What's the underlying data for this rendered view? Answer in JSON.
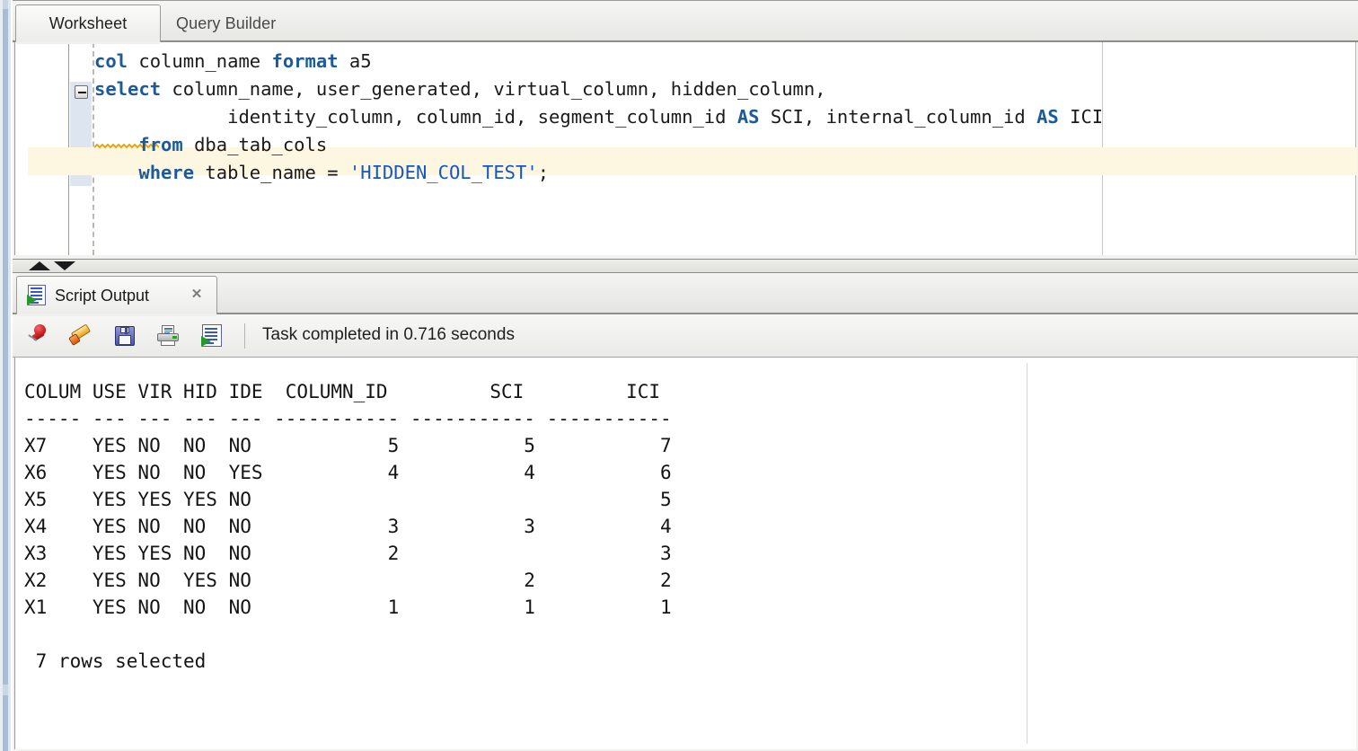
{
  "editor": {
    "tabs": [
      {
        "label": "Worksheet",
        "active": true
      },
      {
        "label": "Query Builder",
        "active": false
      }
    ],
    "code_lines": [
      [
        {
          "t": "col",
          "c": "kw"
        },
        {
          "t": " column_name ",
          "c": ""
        },
        {
          "t": "format",
          "c": "kw"
        },
        {
          "t": " a5",
          "c": ""
        }
      ],
      [
        {
          "t": "select",
          "c": "kw"
        },
        {
          "t": " column_name, user_generated, virtual_column, hidden_column,",
          "c": ""
        }
      ],
      [
        {
          "t": "            identity_column, column_id, segment_column_id ",
          "c": ""
        },
        {
          "t": "AS",
          "c": "kw"
        },
        {
          "t": " SCI, internal_column_id ",
          "c": ""
        },
        {
          "t": "AS",
          "c": "kw"
        },
        {
          "t": " ICI",
          "c": ""
        }
      ],
      [
        {
          "t": "    ",
          "c": ""
        },
        {
          "t": "from",
          "c": "kw"
        },
        {
          "t": " dba_tab_cols",
          "c": ""
        }
      ],
      [
        {
          "t": "    ",
          "c": ""
        },
        {
          "t": "where",
          "c": "kw"
        },
        {
          "t": " table_name = ",
          "c": ""
        },
        {
          "t": "'HIDDEN_COL_TEST'",
          "c": "str"
        },
        {
          "t": ";",
          "c": ""
        }
      ]
    ],
    "fold_icon": "collapse-minus-icon",
    "colors": {
      "keyword": "#1d5a9c",
      "string": "#1556c4",
      "highlight_band": "#fdf6e0",
      "squiggle": "#e8a317"
    }
  },
  "splitter": {
    "up_icon": "triangle-up-icon",
    "down_icon": "triangle-down-icon"
  },
  "output": {
    "tab": {
      "label": "Script Output",
      "close_label": "✕",
      "icon": "script-output-icon"
    },
    "toolbar": {
      "buttons": [
        {
          "name": "pin-button",
          "icon": "pushpin-icon",
          "title": "Pin"
        },
        {
          "name": "clear-button",
          "icon": "eraser-icon",
          "title": "Clear"
        },
        {
          "name": "save-button",
          "icon": "floppy-disk-icon",
          "title": "Save"
        },
        {
          "name": "print-button",
          "icon": "printer-icon",
          "title": "Print"
        },
        {
          "name": "run-script-button",
          "icon": "script-output-icon",
          "title": "Run Script"
        }
      ],
      "status": "Task completed in 0.716 seconds"
    },
    "result_text": "COLUM USE VIR HID IDE  COLUMN_ID         SCI         ICI\n----- --- --- --- --- ----------- ----------- -----------\nX7    YES NO  NO  NO            5           5           7\nX6    YES NO  NO  YES           4           4           6\nX5    YES YES YES NO                                    5\nX4    YES NO  NO  NO            3           3           4\nX3    YES YES NO  NO            2                       3\nX2    YES NO  YES NO                        2           2\nX1    YES NO  NO  NO            1           1           1\n\n 7 rows selected",
    "table": {
      "headers": [
        "COLUM",
        "USE",
        "VIR",
        "HID",
        "IDE",
        "COLUMN_ID",
        "SCI",
        "ICI"
      ],
      "separator": [
        "-----",
        "---",
        "---",
        "---",
        "---",
        "-----------",
        "-----------",
        "-----------"
      ],
      "rows": [
        [
          "X7",
          "YES",
          "NO",
          "NO",
          "NO",
          "5",
          "5",
          "7"
        ],
        [
          "X6",
          "YES",
          "NO",
          "NO",
          "YES",
          "4",
          "4",
          "6"
        ],
        [
          "X5",
          "YES",
          "YES",
          "YES",
          "NO",
          "",
          "",
          "5"
        ],
        [
          "X4",
          "YES",
          "NO",
          "NO",
          "NO",
          "3",
          "3",
          "4"
        ],
        [
          "X3",
          "YES",
          "YES",
          "NO",
          "NO",
          "2",
          "",
          "3"
        ],
        [
          "X2",
          "YES",
          "NO",
          "YES",
          "NO",
          "",
          "2",
          "2"
        ],
        [
          "X1",
          "YES",
          "NO",
          "NO",
          "NO",
          "1",
          "1",
          "1"
        ]
      ],
      "footer": " 7 rows selected"
    }
  }
}
